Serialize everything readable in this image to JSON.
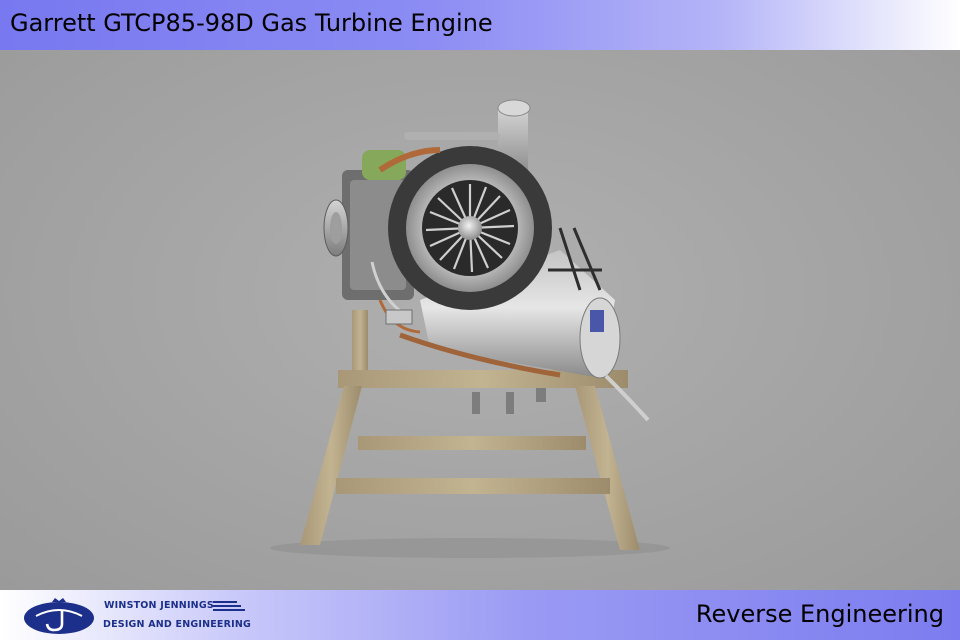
{
  "header": {
    "title": "Garrett GTCP85-98D Gas Turbine Engine"
  },
  "image": {
    "subject": "gas-turbine-engine-on-stand"
  },
  "footer": {
    "company_line1": "WINSTON JENNINGS",
    "company_line2": "DESIGN AND ENGINEERING",
    "label": "Reverse Engineering"
  },
  "colors": {
    "header_accent": "#7878f0",
    "logo_blue": "#1c2f8a",
    "background_gray": "#a6a6a6"
  }
}
